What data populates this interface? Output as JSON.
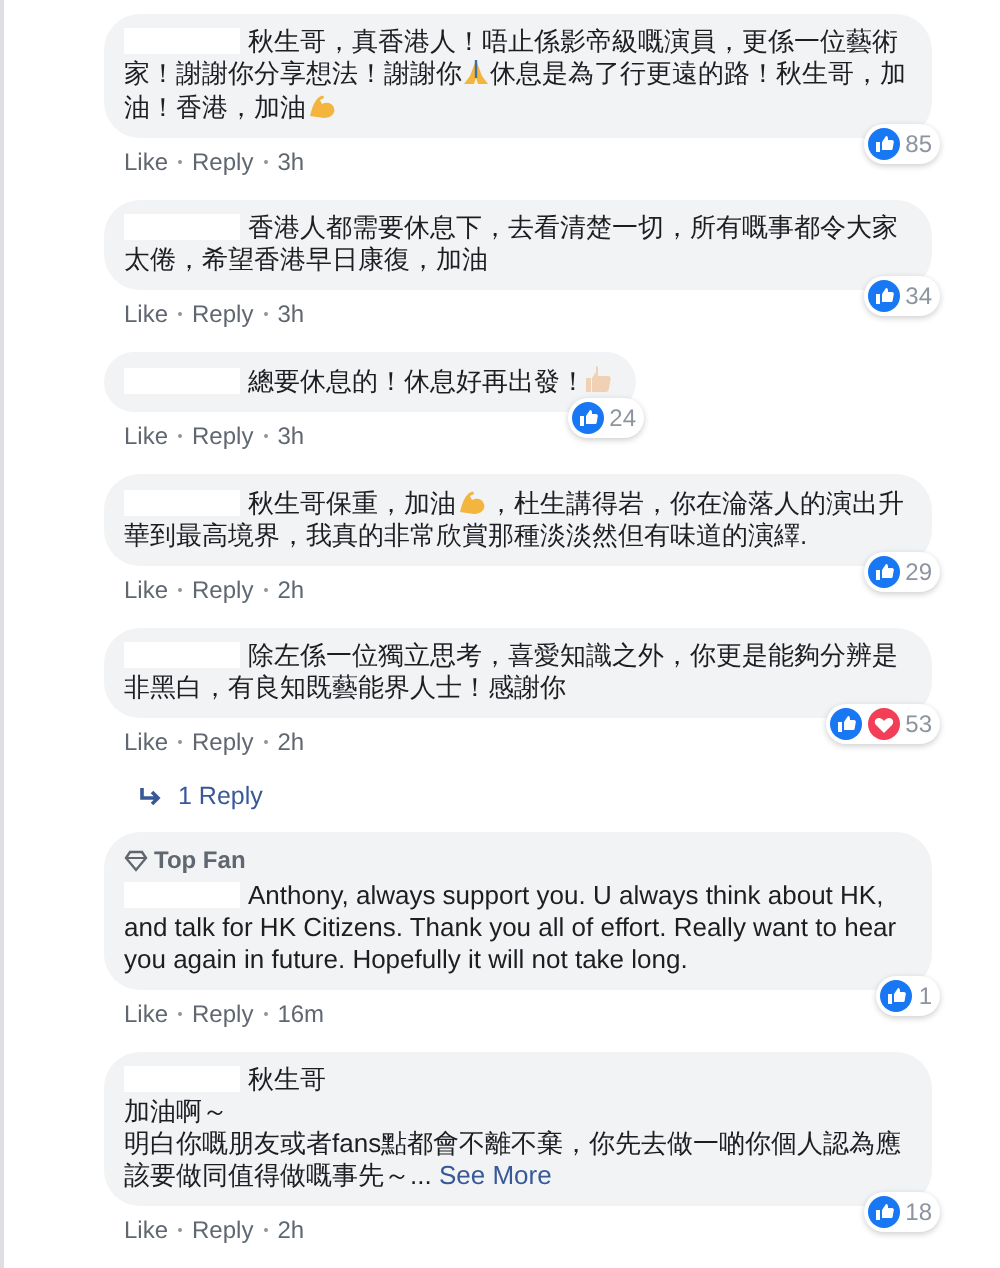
{
  "comments": [
    {
      "name_hidden": true,
      "body": [
        [
          {
            "kind": "text",
            "text": "秋生哥，真香港人！唔止係影帝級嘅演員，更係一位藝術家！謝謝你分享想法！謝謝你"
          },
          {
            "kind": "pray-emoji"
          },
          {
            "kind": "text",
            "text": "休息是為了行更遠的路！秋生哥，加油！香港，加油"
          },
          {
            "kind": "muscle-emoji"
          }
        ]
      ],
      "reactions": {
        "like": true,
        "count": "85"
      },
      "actions": [
        "Like",
        "Reply"
      ],
      "time": "3h"
    },
    {
      "name_hidden": true,
      "body": [
        [
          {
            "kind": "text",
            "text": "香港人都需要休息下，去看清楚一切，所有嘅事都令大家太倦，希望香港早日康復，加油"
          }
        ]
      ],
      "reactions": {
        "like": true,
        "count": "34"
      },
      "actions": [
        "Like",
        "Reply"
      ],
      "time": "3h"
    },
    {
      "name_hidden": true,
      "body": [
        [
          {
            "kind": "text",
            "text": "總要休息的！休息好再出發！"
          },
          {
            "kind": "thumbs-emoji"
          }
        ]
      ],
      "reactions": {
        "like": true,
        "count": "24"
      },
      "actions": [
        "Like",
        "Reply"
      ],
      "time": "3h"
    },
    {
      "name_hidden": true,
      "body": [
        [
          {
            "kind": "text",
            "text": "秋生哥保重，加油"
          },
          {
            "kind": "muscle-emoji"
          },
          {
            "kind": "text",
            "text": "，杜生講得岩，你在淪落人的演出升華到最高境界，我真的非常欣賞那種淡淡然但有味道的演繹."
          }
        ]
      ],
      "reactions": {
        "like": true,
        "count": "29"
      },
      "actions": [
        "Like",
        "Reply"
      ],
      "time": "2h"
    },
    {
      "name_hidden": true,
      "body": [
        [
          {
            "kind": "text",
            "text": "除左係一位獨立思考，喜愛知識之外，你更是能夠分辨是非黑白，有良知既藝能界人士！感謝你"
          }
        ]
      ],
      "reactions": {
        "like": true,
        "love": true,
        "count": "53"
      },
      "actions": [
        "Like",
        "Reply"
      ],
      "time": "2h",
      "replies_link": "1 Reply"
    },
    {
      "name_hidden": true,
      "top_fan_label": "Top Fan",
      "body": [
        [
          {
            "kind": "text",
            "text": "Anthony, always support you. U always think about HK, and talk for HK Citizens. Thank you all of effort. Really want to hear you again in future. Hopefully it will not take long."
          }
        ]
      ],
      "reactions": {
        "like": true,
        "count": "1"
      },
      "actions": [
        "Like",
        "Reply"
      ],
      "time": "16m"
    },
    {
      "name_hidden": true,
      "body": [
        [
          {
            "kind": "text",
            "text": "秋生哥"
          }
        ],
        [
          {
            "kind": "text",
            "text": "加油啊～"
          }
        ],
        [
          {
            "kind": "text",
            "text": "明白你嘅朋友或者fans點都會不離不棄，你先去做一啲你個人認為應該要做同值得做嘅事先～..."
          },
          {
            "kind": "link",
            "text": "See More"
          }
        ]
      ],
      "reactions": {
        "like": true,
        "count": "18"
      },
      "actions": [
        "Like",
        "Reply"
      ],
      "time": "2h"
    }
  ]
}
